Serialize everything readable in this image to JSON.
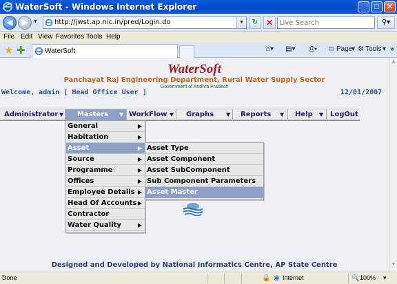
{
  "window": {
    "title": "WaterSoft - Windows Internet Explorer",
    "minimize": "_",
    "maximize": "□",
    "close": "✕"
  },
  "addressbar": {
    "url": "http://jwst.ap.nic.in/pred/Login.do",
    "search_placeholder": "Live Search"
  },
  "menubar": {
    "items": [
      "File",
      "Edit",
      "View",
      "Favorites",
      "Tools",
      "Help"
    ]
  },
  "tabs": {
    "active_tab": "WaterSoft",
    "page_label": "Page",
    "tools_label": "Tools"
  },
  "header": {
    "brand": "WaterSoft",
    "department": "Panchayat Raj Engineering Department, Rural Water Supply Sector",
    "government": "Government of Andhra Pradesh",
    "welcome": "Welcome, admin [ Head Office User ]",
    "date": "12/01/2007"
  },
  "appmenu": {
    "items": [
      {
        "label": "Administrator",
        "arrow": true
      },
      {
        "label": "Masters",
        "arrow": true
      },
      {
        "label": "WorkFlow",
        "arrow": true
      },
      {
        "label": "Graphs",
        "arrow": true
      },
      {
        "label": "Reports",
        "arrow": true
      },
      {
        "label": "Help",
        "arrow": true
      },
      {
        "label": "LogOut",
        "arrow": false
      }
    ],
    "active": "Masters"
  },
  "masters_menu": {
    "items": [
      "General",
      "Habitation",
      "Asset",
      "Source",
      "Programme",
      "Offices",
      "Employee Details",
      "Head Of Accounts",
      "Contractor",
      "Water Quality"
    ],
    "selected": "Asset"
  },
  "asset_menu": {
    "items": [
      "Asset Type",
      "Asset Component",
      "Asset SubComponent",
      "Sub Component Parameters",
      "Asset Master"
    ],
    "selected": "Asset Master"
  },
  "footer": {
    "text": "Designed and Developed by National Informatics Centre, AP State Centre"
  },
  "statusbar": {
    "status": "Done",
    "zone": "Internet",
    "zoom": "100%"
  },
  "colors": {
    "titlebar": "#0848c8",
    "brand": "#b0141c",
    "department": "#c8641c",
    "menu_selected": "#8fa0c8"
  }
}
